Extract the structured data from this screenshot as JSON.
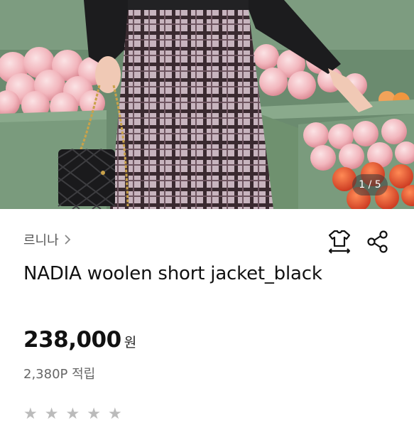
{
  "gallery": {
    "counter": "1 / 5"
  },
  "product": {
    "brand": "르니나",
    "name": "NADIA woolen short jacket_black",
    "price": "238,000",
    "currency": "원",
    "points": "2,380P 적립"
  },
  "icons": {
    "brand_link": "chevron-right-icon",
    "size_guide": "tshirt-size-icon",
    "share": "share-icon"
  },
  "rating": {
    "stars": [
      "★",
      "★",
      "★",
      "★",
      "★"
    ]
  },
  "colors": {
    "text": "#111111",
    "muted": "#666666",
    "shelf": "#7c9c7c"
  }
}
